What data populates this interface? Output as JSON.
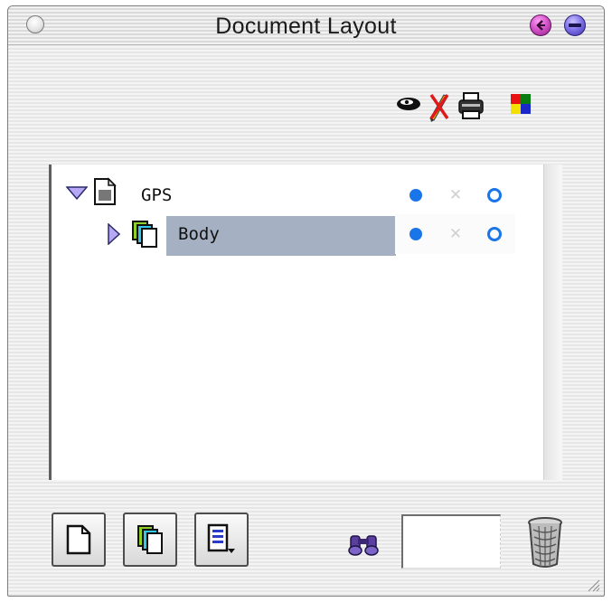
{
  "window": {
    "title": "Document Layout"
  },
  "toolbar": {
    "column_icons": [
      "eye-icon",
      "pencil-icon",
      "printer-icon",
      "color-icon"
    ]
  },
  "tree": {
    "rows": [
      {
        "label": "GPS",
        "expanded": true,
        "visible": true,
        "locked": false,
        "printable": true
      },
      {
        "label": "Body",
        "expanded": false,
        "selected": true,
        "visible": true,
        "locked": false,
        "printable": true
      }
    ]
  },
  "footer": {
    "buttons": [
      "new-page-icon",
      "new-layer-icon",
      "layout-menu-icon"
    ],
    "search_value": ""
  },
  "colors": {
    "selection": "#a5b0c3",
    "status_blue": "#1a76e8"
  }
}
